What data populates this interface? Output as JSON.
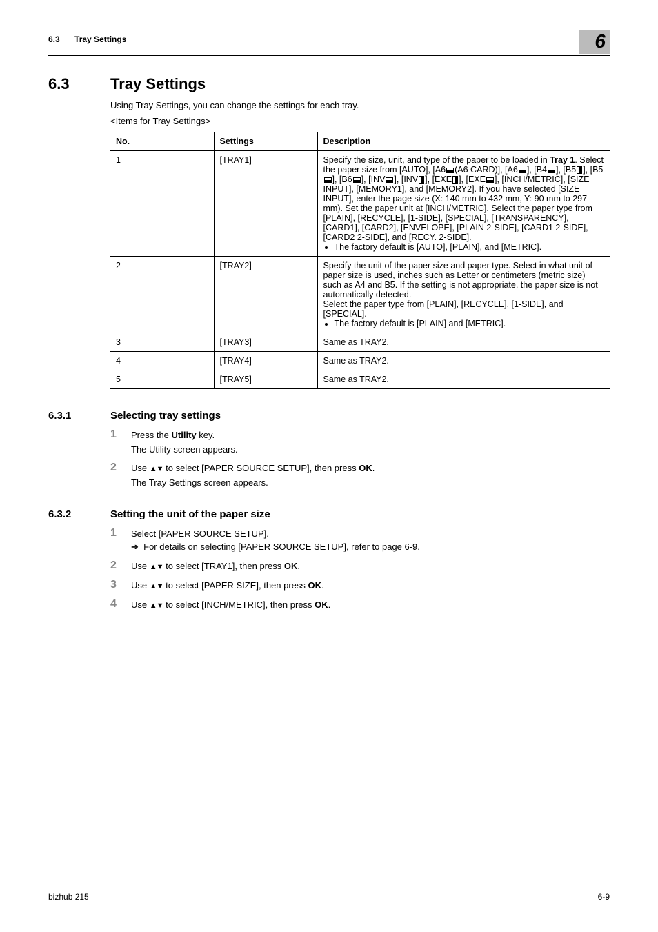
{
  "header": {
    "section_number": "6.3",
    "section_name": "Tray Settings",
    "chapter_number": "6"
  },
  "section": {
    "number": "6.3",
    "title": "Tray Settings",
    "intro": "Using Tray Settings, you can change the settings for each tray.",
    "items_for": "<Items for Tray Settings>"
  },
  "table": {
    "headers": {
      "no": "No.",
      "settings": "Settings",
      "description": "Description"
    },
    "rows": [
      {
        "no": "1",
        "settings": "[TRAY1]",
        "desc_pre_bold": "Specify the size, unit, and type of the paper to be loaded in ",
        "desc_bold": "Tray 1",
        "desc_post_bold_a": ". Select the paper size from [AUTO], [A6",
        "desc_post_bold_b": "(A6 CARD)], [A6",
        "desc_post_bold_c": "], [B4",
        "desc_post_bold_d": "], [B5",
        "desc_post_bold_e": "], [B5",
        "desc_post_bold_f": "], [B6",
        "desc_post_bold_g": "], [INV",
        "desc_post_bold_h": "], [INV",
        "desc_post_bold_i": "], [EXE",
        "desc_post_bold_j": "], [EXE",
        "desc_post_bold_k": "], [INCH/METRIC], [SIZE INPUT], [MEMORY1], and [MEMORY2]. If you have selected [SIZE INPUT], enter the page size (X: 140 mm to 432 mm, Y: 90 mm to 297 mm). Set the paper unit at [INCH/METRIC]. Select the paper type from [PLAIN], [RECYCLE], [1-SIDE], [SPECIAL], [TRANSPARENCY], [CARD1], [CARD2], [ENVELOPE], [PLAIN 2-SIDE], [CARD1 2-SIDE], [CARD2 2-SIDE], and [RECY. 2-SIDE].",
        "bullet": "The factory default is [AUTO], [PLAIN], and [METRIC]."
      },
      {
        "no": "2",
        "settings": "[TRAY2]",
        "desc_main": "Specify the unit of the paper size and paper type. Select in what unit of paper size is used, inches such as Letter or centimeters (metric size) such as A4 and B5. If the setting is not appropriate, the paper size is not automatically detected.\nSelect the paper type from [PLAIN], [RECYCLE], [1-SIDE], and [SPECIAL].",
        "bullet": "The factory default is [PLAIN] and [METRIC]."
      },
      {
        "no": "3",
        "settings": "[TRAY3]",
        "desc_main": "Same as TRAY2."
      },
      {
        "no": "4",
        "settings": "[TRAY4]",
        "desc_main": "Same as TRAY2."
      },
      {
        "no": "5",
        "settings": "[TRAY5]",
        "desc_main": "Same as TRAY2."
      }
    ]
  },
  "sub1": {
    "number": "6.3.1",
    "title": "Selecting tray settings",
    "steps": [
      {
        "n": "1",
        "pre": "Press the ",
        "bold": "Utility",
        "post": " key.",
        "result": "The Utility screen appears."
      },
      {
        "n": "2",
        "pre": "Use ",
        "icon": true,
        "mid": " to select [PAPER SOURCE SETUP], then press ",
        "bold": "OK",
        "post": ".",
        "result": "The Tray Settings screen appears."
      }
    ]
  },
  "sub2": {
    "number": "6.3.2",
    "title": "Setting the unit of the paper size",
    "steps": [
      {
        "n": "1",
        "line": "Select [PAPER SOURCE SETUP].",
        "sub_arrow": "For details on selecting [PAPER SOURCE SETUP], refer to page 6-9."
      },
      {
        "n": "2",
        "pre": "Use ",
        "icon": true,
        "mid": " to select [TRAY1], then press ",
        "bold": "OK",
        "post": "."
      },
      {
        "n": "3",
        "pre": "Use ",
        "icon": true,
        "mid": " to select [PAPER SIZE], then press ",
        "bold": "OK",
        "post": "."
      },
      {
        "n": "4",
        "pre": "Use ",
        "icon": true,
        "mid": " to select [INCH/METRIC], then press ",
        "bold": "OK",
        "post": "."
      }
    ]
  },
  "footer": {
    "left": "bizhub 215",
    "right": "6-9"
  }
}
